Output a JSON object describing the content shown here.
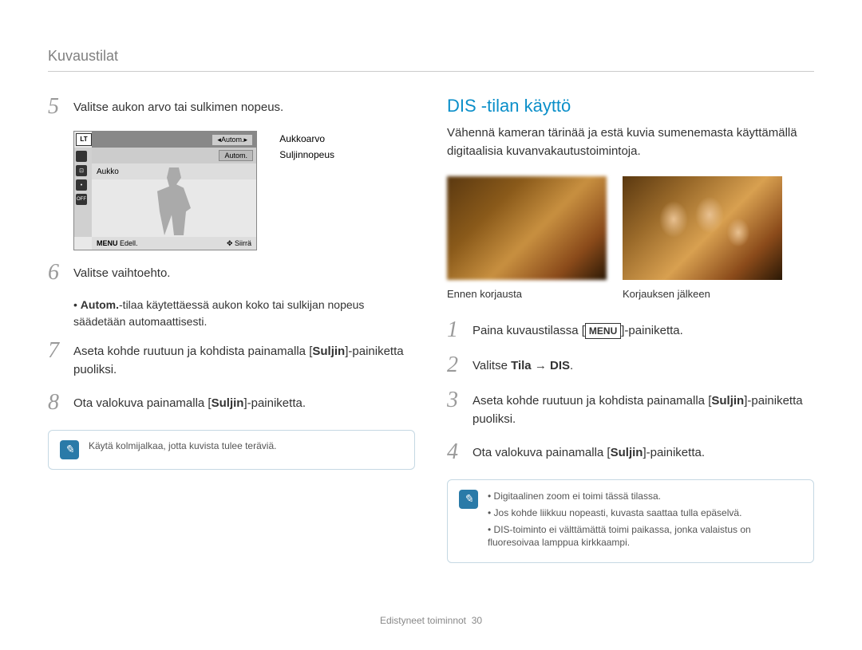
{
  "header": "Kuvaustilat",
  "left": {
    "step5": "Valitse aukon arvo tai sulkimen nopeus.",
    "screen": {
      "lt": "LT",
      "autom1": "Autom.",
      "autom2": "Autom.",
      "aukko": "Aukko",
      "menu": "MENU",
      "edell": "Edell.",
      "siirra": "Siirrä",
      "callout1": "Aukkoarvo",
      "callout2": "Suljinnopeus"
    },
    "step6": "Valitse vaihtoehto.",
    "step6_sub_prefix": "• ",
    "step6_sub_b": "Autom.",
    "step6_sub_rest": "-tilaa käytettäessä aukon koko tai sulkijan nopeus säädetään automaattisesti.",
    "step7_pre": "Aseta kohde ruutuun ja kohdista painamalla [",
    "step7_b": "Suljin",
    "step7_post": "]-painiketta puoliksi.",
    "step8_pre": "Ota valokuva painamalla [",
    "step8_b": "Suljin",
    "step8_post": "]-painiketta.",
    "note": "Käytä kolmijalkaa, jotta kuvista tulee teräviä."
  },
  "right": {
    "title": "DIS -tilan käyttö",
    "intro": "Vähennä kameran tärinää ja estä kuvia sumenemasta käyttämällä digitaalisia kuvanvakautustoimintoja.",
    "caption_before": "Ennen korjausta",
    "caption_after": "Korjauksen jälkeen",
    "step1_pre": "Paina kuvaustilassa [",
    "step1_menu": "MENU",
    "step1_post": "]-painiketta.",
    "step2_pre": "Valitse ",
    "step2_b": "Tila → DIS",
    "step2_post": ".",
    "step3_pre": "Aseta kohde ruutuun ja kohdista painamalla [",
    "step3_b": "Suljin",
    "step3_post": "]-painiketta puoliksi.",
    "step4_pre": "Ota valokuva painamalla [",
    "step4_b": "Suljin",
    "step4_post": "]-painiketta.",
    "notes": [
      "Digitaalinen zoom ei toimi tässä tilassa.",
      "Jos kohde liikkuu nopeasti, kuvasta saattaa tulla epäselvä.",
      "DIS-toiminto ei välttämättä toimi paikassa, jonka valaistus on fluoresoivaa lamppua kirkkaampi."
    ]
  },
  "footer_label": "Edistyneet toiminnot",
  "footer_page": "30"
}
